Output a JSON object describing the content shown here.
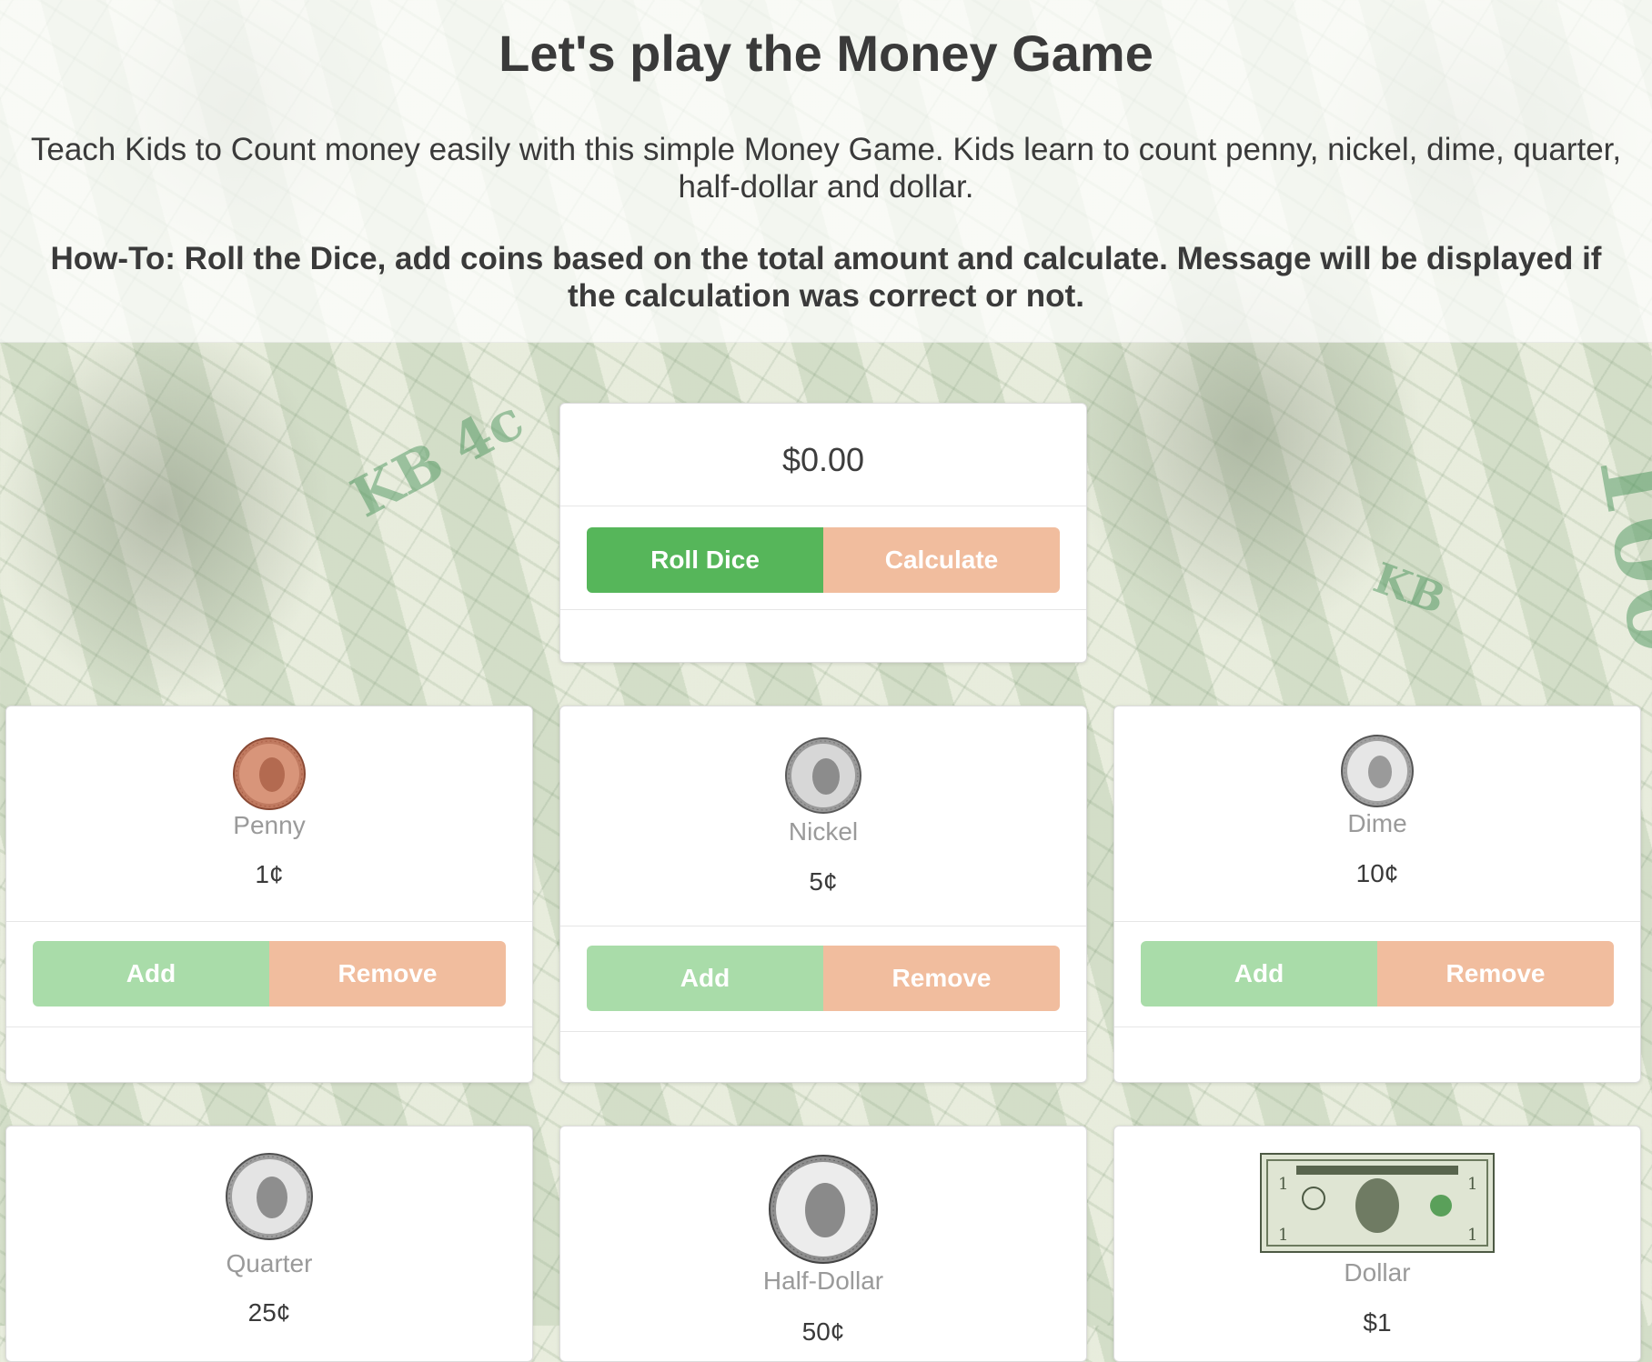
{
  "header": {
    "title": "Let's play the Money Game",
    "intro": "Teach Kids to Count money easily with this simple Money Game. Kids learn to count penny, nickel, dime, quarter, half-dollar and dollar.",
    "howto": "How-To: Roll the Dice, add coins based on the total amount and calculate. Message will be displayed if the calculation was correct or not."
  },
  "game": {
    "total": "$0.00",
    "roll_label": "Roll Dice",
    "calculate_label": "Calculate"
  },
  "coins": [
    {
      "name": "Penny",
      "value": "1¢",
      "add_label": "Add",
      "remove_label": "Remove",
      "icon": "penny-icon"
    },
    {
      "name": "Nickel",
      "value": "5¢",
      "add_label": "Add",
      "remove_label": "Remove",
      "icon": "nickel-icon"
    },
    {
      "name": "Dime",
      "value": "10¢",
      "add_label": "Add",
      "remove_label": "Remove",
      "icon": "dime-icon"
    },
    {
      "name": "Quarter",
      "value": "25¢",
      "icon": "quarter-icon"
    },
    {
      "name": "Half-Dollar",
      "value": "50¢",
      "icon": "half-dollar-icon"
    },
    {
      "name": "Dollar",
      "value": "$1",
      "icon": "dollar-bill-icon"
    }
  ],
  "colors": {
    "roll": "#56b65a",
    "add": "#a9dca9",
    "peach": "#f1bd9e"
  }
}
